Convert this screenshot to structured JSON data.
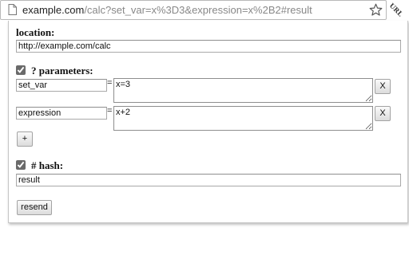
{
  "browser": {
    "url_host": "example.com",
    "url_rest": "/calc?set_var=x%3D3&expression=x%2B2#result",
    "extension_label": "URL"
  },
  "panel": {
    "location": {
      "heading": "location:",
      "value": "http://example.com/calc"
    },
    "parameters": {
      "heading": "? parameters:",
      "checked": true,
      "equals_sign": "=",
      "remove_label": "X",
      "add_label": "+",
      "rows": [
        {
          "name": "set_var",
          "value": "x=3"
        },
        {
          "name": "expression",
          "value": "x+2"
        }
      ]
    },
    "hash": {
      "heading": "# hash:",
      "checked": true,
      "value": "result"
    },
    "resend_label": "resend"
  }
}
